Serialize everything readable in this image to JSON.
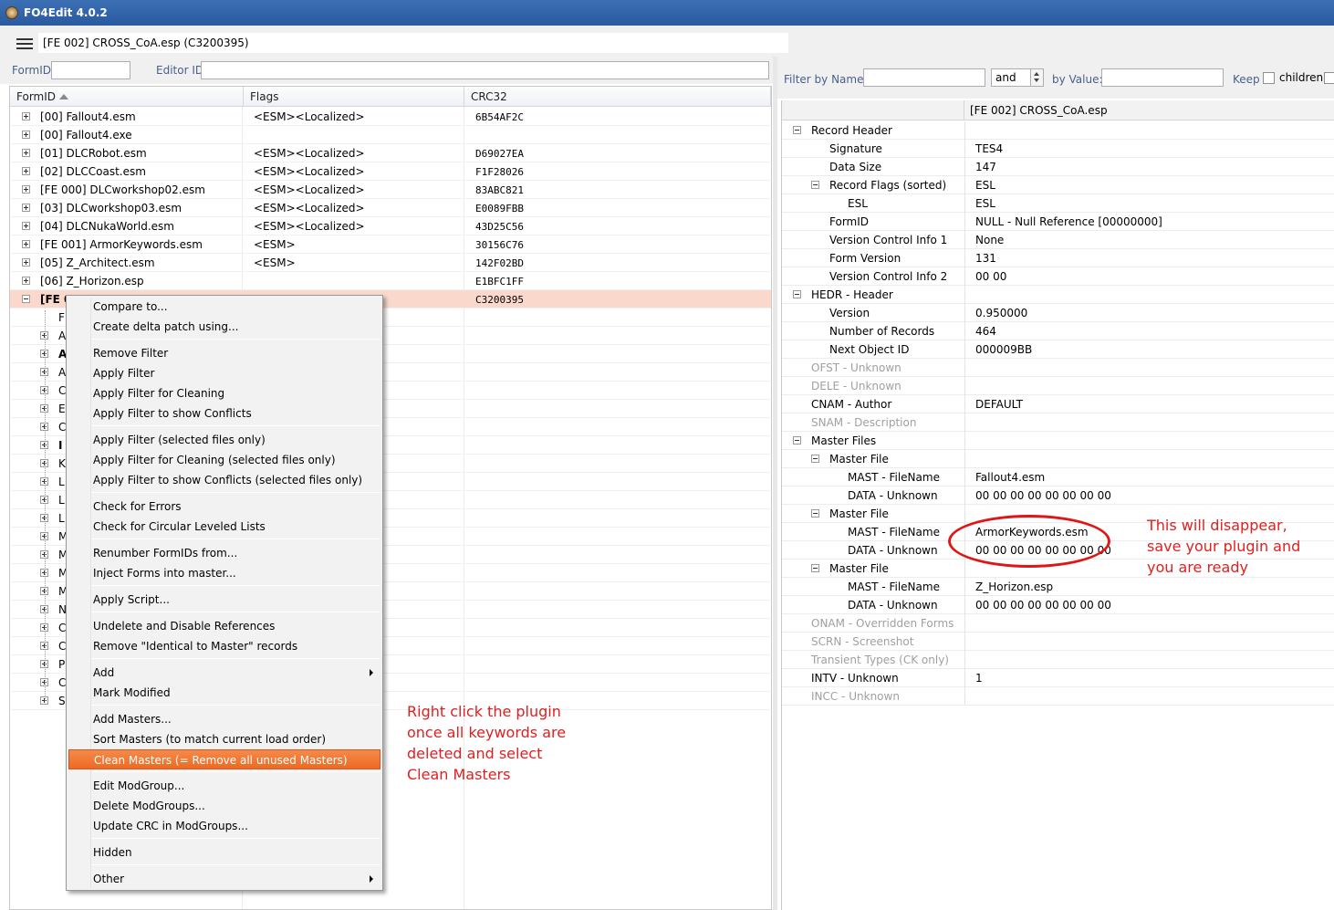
{
  "window": {
    "title": "FO4Edit 4.0.2"
  },
  "toolbar": {
    "path": "[FE 002] CROSS_CoA.esp (C3200395)"
  },
  "search": {
    "formid_label": "FormID",
    "editorid_label": "Editor ID",
    "formid_value": "",
    "editorid_value": ""
  },
  "columns": {
    "formid": "FormID",
    "flags": "Flags",
    "crc32": "CRC32"
  },
  "files": [
    {
      "name": "[00] Fallout4.esm",
      "flags": "<ESM><Localized>",
      "crc": "6B54AF2C"
    },
    {
      "name": "[00] Fallout4.exe",
      "flags": "",
      "crc": ""
    },
    {
      "name": "[01] DLCRobot.esm",
      "flags": "<ESM><Localized>",
      "crc": "D69027EA"
    },
    {
      "name": "[02] DLCCoast.esm",
      "flags": "<ESM><Localized>",
      "crc": "F1F28026"
    },
    {
      "name": "[FE 000] DLCworkshop02.esm",
      "flags": "<ESM><Localized>",
      "crc": "83ABC821"
    },
    {
      "name": "[03] DLCworkshop03.esm",
      "flags": "<ESM><Localized>",
      "crc": "E0089FBB"
    },
    {
      "name": "[04] DLCNukaWorld.esm",
      "flags": "<ESM><Localized>",
      "crc": "43D25C56"
    },
    {
      "name": "[FE 001] ArmorKeywords.esm",
      "flags": "<ESM>",
      "crc": "30156C76"
    },
    {
      "name": "[05] Z_Architect.esm",
      "flags": "<ESM>",
      "crc": "142F02BD"
    },
    {
      "name": "[06] Z_Horizon.esp",
      "flags": "",
      "crc": "E1BFC1FF"
    },
    {
      "name": "[FE 0",
      "flags": "",
      "crc": "C3200395"
    }
  ],
  "children": [
    "F",
    "A",
    "A",
    "A",
    "C",
    "E",
    "C",
    "I",
    "K",
    "L",
    "L",
    "L",
    "M",
    "M",
    "M",
    "M",
    "N",
    "C",
    "C",
    "P",
    "C",
    "S"
  ],
  "filter": {
    "filter_by_name": "Filter by Name:",
    "name_value": "",
    "op": "and",
    "by_value": "by Value:",
    "value_value": "",
    "keep": "Keep",
    "children": "children"
  },
  "record": {
    "header": "[FE 002] CROSS_CoA.esp",
    "rows": [
      {
        "label": "Record Header",
        "value": "",
        "level": 0,
        "exp": "minus"
      },
      {
        "label": "Signature",
        "value": "TES4",
        "level": 1
      },
      {
        "label": "Data Size",
        "value": "147",
        "level": 1
      },
      {
        "label": "Record Flags (sorted)",
        "value": "ESL",
        "level": 1,
        "exp": "minus"
      },
      {
        "label": "ESL",
        "value": "ESL",
        "level": 2
      },
      {
        "label": "FormID",
        "value": "NULL - Null Reference [00000000]",
        "level": 1
      },
      {
        "label": "Version Control Info 1",
        "value": "None",
        "level": 1
      },
      {
        "label": "Form Version",
        "value": "131",
        "level": 1
      },
      {
        "label": "Version Control Info 2",
        "value": "00 00",
        "level": 1
      },
      {
        "label": "HEDR - Header",
        "value": "",
        "level": 0,
        "exp": "minus"
      },
      {
        "label": "Version",
        "value": "0.950000",
        "level": 1
      },
      {
        "label": "Number of Records",
        "value": "464",
        "level": 1
      },
      {
        "label": "Next Object ID",
        "value": "000009BB",
        "level": 1
      },
      {
        "label": "OFST - Unknown",
        "value": "",
        "level": 0,
        "gray": true
      },
      {
        "label": "DELE - Unknown",
        "value": "",
        "level": 0,
        "gray": true
      },
      {
        "label": "CNAM - Author",
        "value": "DEFAULT",
        "level": 0
      },
      {
        "label": "SNAM - Description",
        "value": "",
        "level": 0,
        "gray": true
      },
      {
        "label": "Master Files",
        "value": "",
        "level": 0,
        "exp": "minus"
      },
      {
        "label": "Master File",
        "value": "",
        "level": 1,
        "exp": "minus"
      },
      {
        "label": "MAST - FileName",
        "value": "Fallout4.esm",
        "level": 2
      },
      {
        "label": "DATA - Unknown",
        "value": "00 00 00 00 00 00 00 00",
        "level": 2
      },
      {
        "label": "Master File",
        "value": "",
        "level": 1,
        "exp": "minus"
      },
      {
        "label": "MAST - FileName",
        "value": "ArmorKeywords.esm",
        "level": 2
      },
      {
        "label": "DATA - Unknown",
        "value": "00 00 00 00 00 00 00 00",
        "level": 2
      },
      {
        "label": "Master File",
        "value": "",
        "level": 1,
        "exp": "minus"
      },
      {
        "label": "MAST - FileName",
        "value": "Z_Horizon.esp",
        "level": 2
      },
      {
        "label": "DATA - Unknown",
        "value": "00 00 00 00 00 00 00 00",
        "level": 2
      },
      {
        "label": "ONAM - Overridden Forms",
        "value": "",
        "level": 0,
        "gray": true
      },
      {
        "label": "SCRN - Screenshot",
        "value": "",
        "level": 0,
        "gray": true
      },
      {
        "label": "Transient Types (CK only)",
        "value": "",
        "level": 0,
        "gray": true
      },
      {
        "label": "INTV - Unknown",
        "value": "1",
        "level": 0
      },
      {
        "label": "INCC - Unknown",
        "value": "",
        "level": 0,
        "gray": true
      }
    ]
  },
  "context_menu": {
    "groups": [
      [
        "Compare to...",
        "Create delta patch using..."
      ],
      [
        "Remove Filter",
        "Apply Filter",
        "Apply Filter for Cleaning",
        "Apply Filter to show Conflicts"
      ],
      [
        "Apply Filter (selected files only)",
        "Apply Filter for Cleaning (selected files only)",
        "Apply Filter to show Conflicts (selected files only)"
      ],
      [
        "Check for Errors",
        "Check for Circular Leveled Lists"
      ],
      [
        "Renumber FormIDs from...",
        "Inject Forms into master..."
      ],
      [
        "Apply Script..."
      ],
      [
        "Undelete and Disable References",
        "Remove \"Identical to Master\" records"
      ],
      [
        "Add",
        "Mark Modified"
      ],
      [
        "Add Masters...",
        "Sort Masters (to match current load order)",
        "Clean Masters (= Remove all unused Masters)"
      ],
      [
        "Edit ModGroup...",
        "Delete ModGroups...",
        "Update CRC in ModGroups..."
      ],
      [
        "Hidden"
      ],
      [
        "Other"
      ]
    ],
    "highlighted": "Clean Masters (= Remove all unused Masters)",
    "submenus": [
      "Add",
      "Other"
    ]
  },
  "annotations": {
    "left": [
      "Right click the plugin",
      "once all keywords are",
      "deleted and select",
      "Clean Masters"
    ],
    "right": [
      "This will disappear,",
      "save your plugin and",
      "you are ready"
    ],
    "color": "#e02020"
  }
}
